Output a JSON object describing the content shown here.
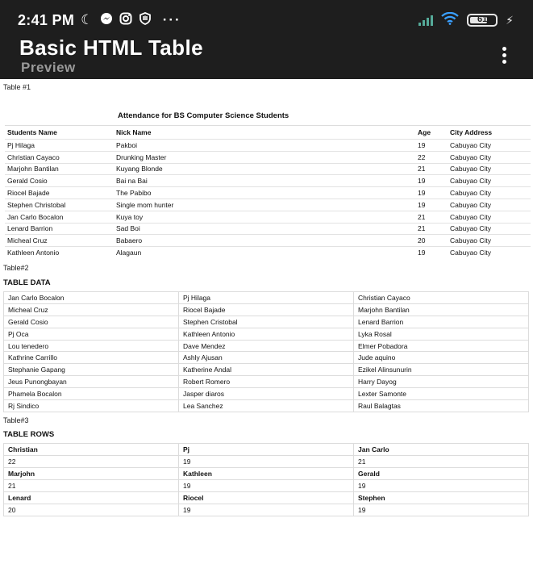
{
  "status_bar": {
    "time": "2:41 PM",
    "icons": [
      "moon-icon",
      "messenger-icon",
      "instagram-icon",
      "vpn-icon",
      "more-dots-icon"
    ],
    "battery": "61"
  },
  "app_bar": {
    "title": "Basic HTML Table",
    "subtitle": "Preview"
  },
  "table1": {
    "label": "Table #1",
    "caption": "Attendance for BS Computer Science Students",
    "headers": [
      "Students Name",
      "Nick Name",
      "Age",
      "City Address"
    ],
    "rows": [
      [
        "Pj Hilaga",
        "Pakboi",
        "19",
        "Cabuyao City"
      ],
      [
        "Christian Cayaco",
        "Drunking Master",
        "22",
        "Cabuyao City"
      ],
      [
        "Marjohn Bantilan",
        "Kuyang Blonde",
        "21",
        "Cabuyao City"
      ],
      [
        "Gerald Cosio",
        "Bai na Bai",
        "19",
        "Cabuyao City"
      ],
      [
        "Riocel Bajade",
        "The Pabibo",
        "19",
        "Cabuyao City"
      ],
      [
        "Stephen Christobal",
        "Single mom hunter",
        "19",
        "Cabuyao City"
      ],
      [
        "Jan Carlo Bocalon",
        "Kuya toy",
        "21",
        "Cabuyao City"
      ],
      [
        "Lenard Barrion",
        "Sad Boi",
        "21",
        "Cabuyao City"
      ],
      [
        "Micheal Cruz",
        "Babaero",
        "20",
        "Cabuyao City"
      ],
      [
        "Kathleen Antonio",
        "Alagaun",
        "19",
        "Cabuyao City"
      ]
    ]
  },
  "table2": {
    "label": "Table#2",
    "heading": "TABLE DATA",
    "rows": [
      [
        "Jan Carlo Bocalon",
        "Pj Hilaga",
        "Christian Cayaco"
      ],
      [
        "Micheal Cruz",
        "Riocel Bajade",
        "Marjohn Bantilan"
      ],
      [
        "Gerald Cosio",
        "Stephen Cristobal",
        "Lenard Barrion"
      ],
      [
        "Pj Oca",
        "Kathleen Antonio",
        "Lyka Rosal"
      ],
      [
        "Lou tenedero",
        "Dave Mendez",
        "Elmer Pobadora"
      ],
      [
        "Kathrine Carrillo",
        "Ashly Ajusan",
        "Jude aquino"
      ],
      [
        "Stephanie Gapang",
        "Katherine Andal",
        "Ezikel Alinsunurin"
      ],
      [
        "Jeus Punongbayan",
        "Robert Romero",
        "Harry Dayog"
      ],
      [
        "Phamela Bocalon",
        "Jasper diaros",
        "Lexter Samonte"
      ],
      [
        "Rj Sindico",
        "Lea Sanchez",
        "Raul Balagtas"
      ]
    ]
  },
  "table3": {
    "label": "Table#3",
    "heading": "TABLE ROWS",
    "groups": [
      {
        "names": [
          "Christian",
          "Pj",
          "Jan Carlo"
        ],
        "ages": [
          "22",
          "19",
          "21"
        ]
      },
      {
        "names": [
          "Marjohn",
          "Kathleen",
          "Gerald"
        ],
        "ages": [
          "21",
          "19",
          "19"
        ]
      },
      {
        "names": [
          "Lenard",
          "Riocel",
          "Stephen"
        ],
        "ages": [
          "20",
          "19",
          "19"
        ]
      }
    ]
  }
}
